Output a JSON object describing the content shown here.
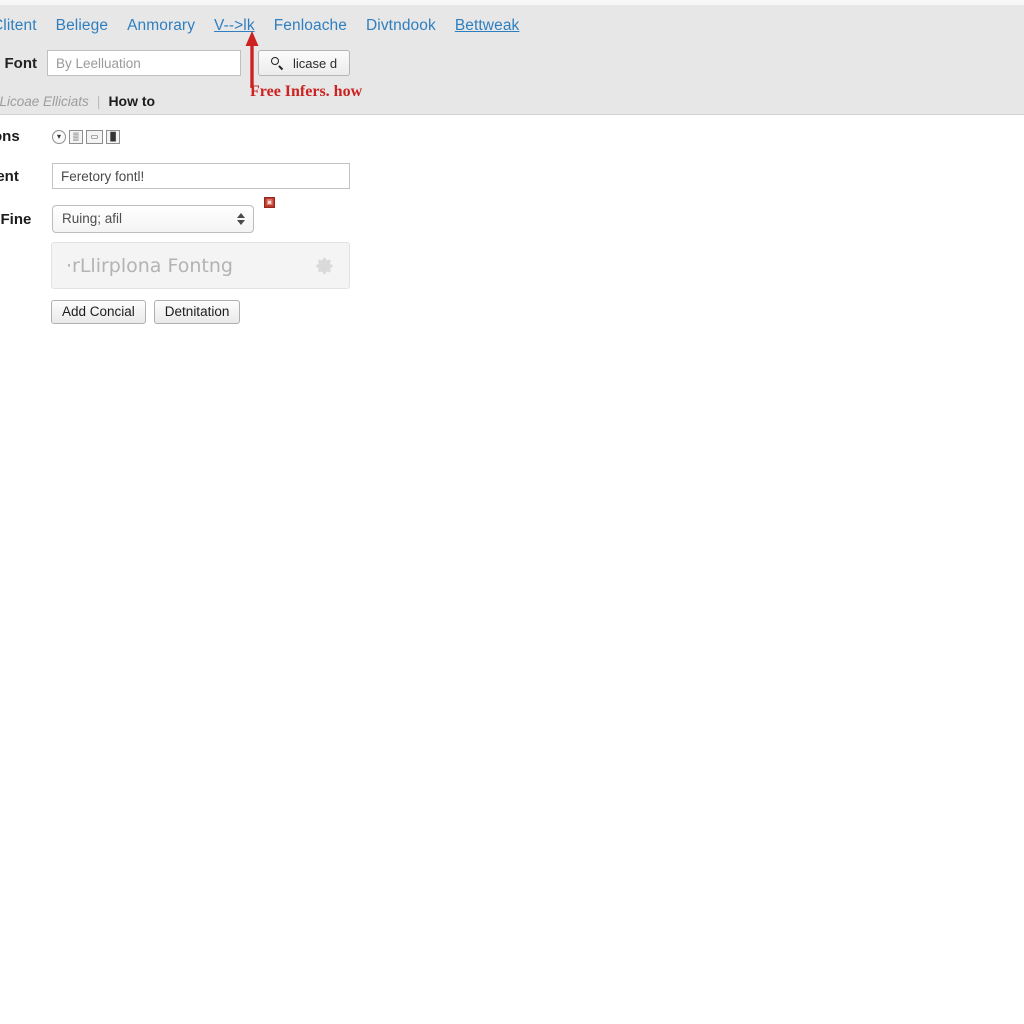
{
  "header": {
    "nav_items": [
      {
        "label": "Clitent",
        "underlined": false
      },
      {
        "label": "Beliege",
        "underlined": false
      },
      {
        "label": "Anmorary",
        "underlined": false
      },
      {
        "label": "V-->lk",
        "underlined": true
      },
      {
        "label": "Fenloache",
        "underlined": false
      },
      {
        "label": "Divtndook",
        "underlined": false
      },
      {
        "label": "Bettweak",
        "underlined": true
      }
    ],
    "search": {
      "label": "e Font",
      "value": "",
      "placeholder": "By Leelluation",
      "button_label": "licase d",
      "button_icon": "search-icon"
    },
    "breadcrumb": {
      "muted": "/ Licoae Elliciats",
      "divider": "|",
      "strong": "How to"
    }
  },
  "annotation": {
    "text": "Free Infers. how",
    "color": "#cc2222",
    "arrow_icon": "up-arrow-icon"
  },
  "main": {
    "rows": {
      "icons": {
        "label": "fons",
        "toolbar": [
          {
            "name": "dropdown-caret-button",
            "glyph": "▾",
            "shape": "round"
          },
          {
            "name": "image-tool-button",
            "glyph": "▒",
            "shape": "square"
          },
          {
            "name": "link-tool-button",
            "glyph": "▭",
            "shape": "wide"
          },
          {
            "name": "columns-tool-button",
            "glyph": "▐▌",
            "shape": "square"
          }
        ]
      },
      "text": {
        "label": "cent",
        "value": "Feretory fontl!",
        "placeholder": ""
      },
      "select": {
        "label": "e Fine",
        "selected": "Ruing; afil",
        "options": [
          "Ruing; afil"
        ],
        "badge_label": "▣",
        "badge_color": "#c0392b"
      }
    },
    "preview": {
      "text": "·rLlirplona Fontng",
      "gear_icon": "gear-icon"
    },
    "actions": [
      {
        "label": "Add Concial"
      },
      {
        "label": "Detnitation"
      }
    ]
  },
  "colors": {
    "header_bg": "#e7e7e7",
    "nav_link": "#2f7fc0",
    "annotation_red": "#cc2222",
    "body_bg": "#ffffff"
  }
}
